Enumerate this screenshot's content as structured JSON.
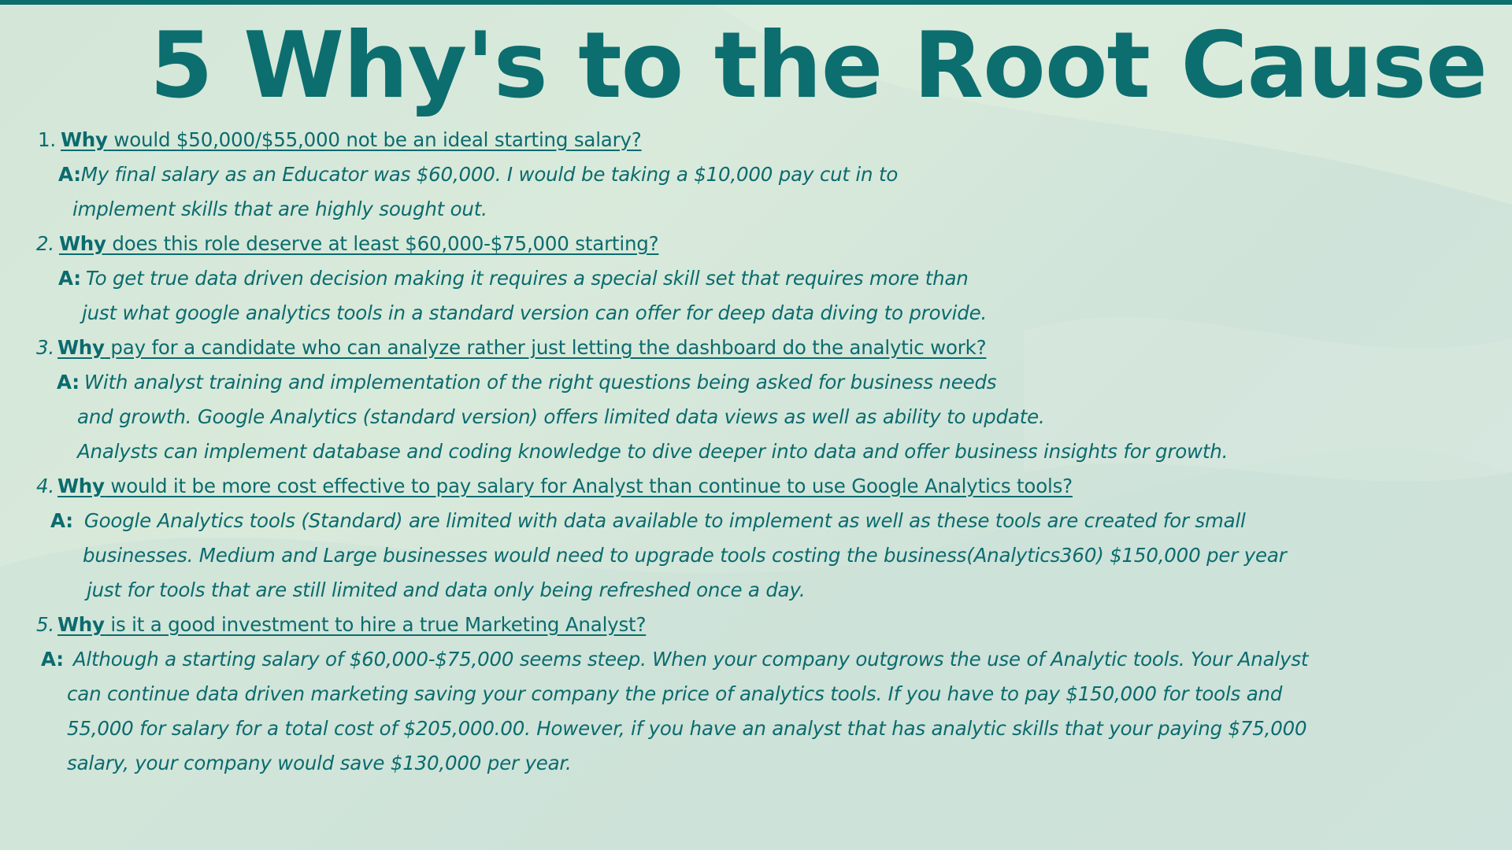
{
  "title": "5 Why's to the Root Cause",
  "colors": {
    "accent": "#0c6e6f",
    "background": "#d5e8da"
  },
  "questions": [
    {
      "number": "1.",
      "why": "Why",
      "question": " would  $50,000/$55,000 not be an ideal starting salary?",
      "answer_label": "A:",
      "answer_lines": [
        "My final salary as an Educator was $60,000. I would be taking a $10,000 pay cut in to",
        "implement skills that are highly sought out."
      ]
    },
    {
      "number": "2.",
      "why": "Why",
      "question": " does this role deserve at least $60,000-$75,000 starting?",
      "answer_label": "A:",
      "answer_lines": [
        "To get true data driven decision making it requires a special skill set that requires more than",
        "just what google analytics tools in a standard version can offer for deep data diving to provide."
      ]
    },
    {
      "number": "3.",
      "why": "Why",
      "question": " pay for a candidate who can analyze rather just letting the dashboard do the analytic work? ",
      "answer_label": "A:",
      "answer_lines": [
        "With analyst training and implementation of the right questions being asked for business needs",
        "and growth. Google Analytics (standard version) offers limited data views as well as ability to update.",
        "Analysts can implement database and coding knowledge to dive deeper into data and offer business insights for growth."
      ]
    },
    {
      "number": "4.",
      "why": "Why",
      "question": " would it be more cost effective to pay salary for Analyst than continue to use Google Analytics tools?",
      "answer_label": "A:",
      "answer_lines": [
        "Google Analytics tools (Standard) are limited with data available to implement as well as these tools are created for small",
        "businesses. Medium and Large businesses would need to upgrade tools costing the business(Analytics360) $150,000 per year",
        "just for tools that are still limited and data only being refreshed once a day."
      ]
    },
    {
      "number": "5.",
      "why": "Why",
      "question": " is it a good investment to hire a true Marketing Analyst?",
      "answer_label": "A:",
      "answer_lines": [
        "Although a starting salary of $60,000-$75,000 seems steep. When your company outgrows the use of Analytic tools. Your Analyst",
        "can continue data driven marketing saving your company the price of analytics tools. If you have to pay $150,000 for tools and",
        "55,000 for salary for a total cost of $205,000.00. However, if you have an analyst that has analytic skills that your paying $75,000",
        "salary, your company would save $130,000 per year."
      ]
    }
  ]
}
